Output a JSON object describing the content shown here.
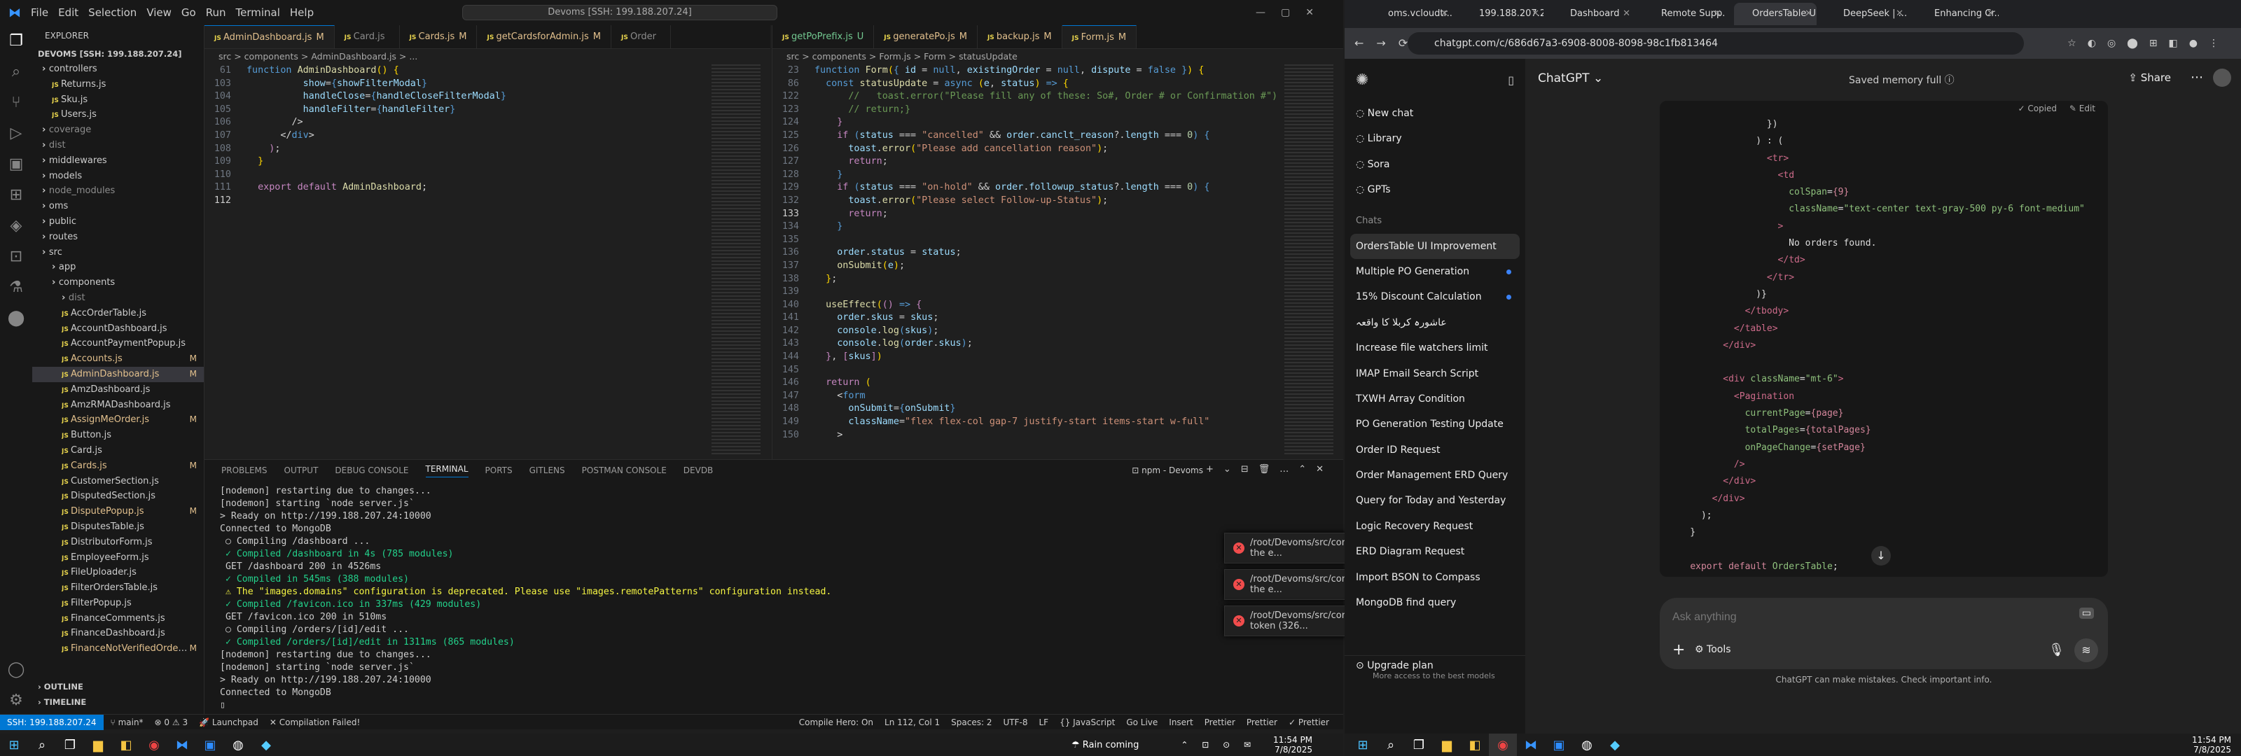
{
  "vscode": {
    "menu": [
      "File",
      "Edit",
      "Selection",
      "View",
      "Go",
      "Run",
      "Terminal",
      "Help"
    ],
    "search": "Devoms [SSH: 199.188.207.24]",
    "explorer_title": "EXPLORER",
    "workspace": "DEVOMS [SSH: 199.188.207.24]",
    "tree": [
      {
        "label": "controllers",
        "type": "folder",
        "status": ""
      },
      {
        "label": "Returns.js",
        "type": "file",
        "status": ""
      },
      {
        "label": "Sku.js",
        "type": "file",
        "status": ""
      },
      {
        "label": "Users.js",
        "type": "file",
        "status": ""
      },
      {
        "label": "coverage",
        "type": "folder",
        "status": ""
      },
      {
        "label": "dist",
        "type": "folder",
        "status": ""
      },
      {
        "label": "middlewares",
        "type": "folder",
        "status": ""
      },
      {
        "label": "models",
        "type": "folder",
        "status": ""
      },
      {
        "label": "node_modules",
        "type": "folder",
        "status": ""
      },
      {
        "label": "oms",
        "type": "folder",
        "status": ""
      },
      {
        "label": "public",
        "type": "folder",
        "status": ""
      },
      {
        "label": "routes",
        "type": "folder",
        "status": ""
      },
      {
        "label": "src",
        "type": "folder",
        "status": ""
      },
      {
        "label": "app",
        "type": "folder",
        "status": ""
      },
      {
        "label": "components",
        "type": "folder",
        "status": ""
      },
      {
        "label": "dist",
        "type": "folder",
        "status": ""
      },
      {
        "label": "AccOrderTable.js",
        "type": "file",
        "status": ""
      },
      {
        "label": "AccountDashboard.js",
        "type": "file",
        "status": ""
      },
      {
        "label": "AccountPaymentPopup.js",
        "type": "file",
        "status": ""
      },
      {
        "label": "Accounts.js",
        "type": "file",
        "status": "M"
      },
      {
        "label": "AdminDashboard.js",
        "type": "file",
        "status": "M"
      },
      {
        "label": "AmzDashboard.js",
        "type": "file",
        "status": ""
      },
      {
        "label": "AmzRMADashboard.js",
        "type": "file",
        "status": ""
      },
      {
        "label": "AssignMeOrder.js",
        "type": "file",
        "status": "M"
      },
      {
        "label": "Button.js",
        "type": "file",
        "status": ""
      },
      {
        "label": "Card.js",
        "type": "file",
        "status": ""
      },
      {
        "label": "Cards.js",
        "type": "file",
        "status": "M"
      },
      {
        "label": "CustomerSection.js",
        "type": "file",
        "status": ""
      },
      {
        "label": "DisputedSection.js",
        "type": "file",
        "status": ""
      },
      {
        "label": "DisputePopup.js",
        "type": "file",
        "status": "M"
      },
      {
        "label": "DisputesTable.js",
        "type": "file",
        "status": ""
      },
      {
        "label": "DistributorForm.js",
        "type": "file",
        "status": ""
      },
      {
        "label": "EmployeeForm.js",
        "type": "file",
        "status": ""
      },
      {
        "label": "FileUploader.js",
        "type": "file",
        "status": ""
      },
      {
        "label": "FilterOrdersTable.js",
        "type": "file",
        "status": ""
      },
      {
        "label": "FilterPopup.js",
        "type": "file",
        "status": ""
      },
      {
        "label": "FinanceComments.js",
        "type": "file",
        "status": ""
      },
      {
        "label": "FinanceDashboard.js",
        "type": "file",
        "status": ""
      },
      {
        "label": "FinanceNotVerifiedOrderT...",
        "type": "file",
        "status": "M"
      }
    ],
    "outline": "OUTLINE",
    "timeline": "TIMELINE",
    "tabs1": [
      {
        "label": "AdminDashboard.js",
        "mod": "M",
        "active": true
      },
      {
        "label": "Card.js",
        "mod": "",
        "active": false
      },
      {
        "label": "Cards.js",
        "mod": "M",
        "active": false
      },
      {
        "label": "getCardsforAdmin.js",
        "mod": "M",
        "active": false
      },
      {
        "label": "Order",
        "mod": "",
        "active": false
      }
    ],
    "tabs2": [
      {
        "label": "getPoPrefix.js",
        "mod": "U",
        "active": false
      },
      {
        "label": "generatePo.js",
        "mod": "M",
        "active": false
      },
      {
        "label": "backup.js",
        "mod": "M",
        "active": false
      },
      {
        "label": "Form.js",
        "mod": "M",
        "active": true
      }
    ],
    "crumb1": "src > components > AdminDashboard.js > ...",
    "crumb2": "src > components > Form.js > Form > statusUpdate",
    "panel_tabs": [
      "PROBLEMS",
      "OUTPUT",
      "DEBUG CONSOLE",
      "TERMINAL",
      "PORTS",
      "GITLENS",
      "POSTMAN CONSOLE",
      "DEVDB"
    ],
    "terminal_label": "npm - Devoms",
    "terminal": [
      "[nodemon] restarting due to changes...",
      "[nodemon] starting `node server.js`",
      "> Ready on http://199.188.207.24:10000",
      "Connected to MongoDB",
      " ○ Compiling /dashboard ...",
      " ✓ Compiled /dashboard in 4s (785 modules)",
      " GET /dashboard 200 in 4526ms",
      " ✓ Compiled in 545ms (388 modules)",
      " ⚠ The \"images.domains\" configuration is deprecated. Please use \"images.remotePatterns\" configuration instead.",
      " ✓ Compiled /favicon.ico in 337ms (429 modules)",
      " GET /favicon.ico 200 in 510ms",
      " ○ Compiling /orders/[id]/edit ...",
      " ✓ Compiled /orders/[id]/edit in 1311ms (865 modules)",
      "[nodemon] restarting due to changes...",
      "[nodemon] starting `node server.js`",
      "> Ready on http://199.188.207.24:10000",
      "Connected to MongoDB",
      "▯"
    ],
    "notifications": [
      "/root/Devoms/src/components/AdminDashboard.js: Support for the e...",
      "/root/Devoms/src/components/AdminDashboard.js: Support for the e...",
      "/root/Devoms/src/components/OrdersTable.js: Unexpected token (326..."
    ],
    "status": {
      "ssh": "SSH: 199.188.207.24",
      "branch": "main*",
      "errors": "⊗ 0 ⚠ 3",
      "launchpad": "Launchpad",
      "compile": "Compilation Failed!",
      "right": [
        "Compile Hero: On",
        "Ln 112, Col 1",
        "Spaces: 2",
        "UTF-8",
        "LF",
        "{} JavaScript",
        "Go Live",
        "Insert",
        "Prettier",
        "Prettier",
        "✓ Prettier"
      ]
    }
  },
  "browser": {
    "tabs": [
      {
        "label": "oms.vcloudtr...",
        "active": false
      },
      {
        "label": "199.188.207.2...",
        "active": false
      },
      {
        "label": "Dashboard",
        "active": false
      },
      {
        "label": "Remote Supp...",
        "active": false
      },
      {
        "label": "OrdersTable U",
        "active": true
      },
      {
        "label": "DeepSeek | ...",
        "active": false
      },
      {
        "label": "Enhancing Cr...",
        "active": false
      }
    ],
    "url": "chatgpt.com/c/686d67a3-6908-8008-8098-98c1fb813464",
    "model": "ChatGPT",
    "memory": "Saved memory full",
    "share": "Share",
    "nav": [
      {
        "label": "New chat",
        "icon": "new-chat-icon"
      },
      {
        "label": "Library",
        "icon": "library-icon"
      },
      {
        "label": "Sora",
        "icon": "sora-icon"
      },
      {
        "label": "GPTs",
        "icon": "gpts-icon"
      }
    ],
    "chats_heading": "Chats",
    "chats": [
      {
        "label": "OrdersTable UI Improvement",
        "active": true,
        "dot": false
      },
      {
        "label": "Multiple PO Generation",
        "active": false,
        "dot": true
      },
      {
        "label": "15% Discount Calculation",
        "active": false,
        "dot": true
      },
      {
        "label": "عاشورہ کربلا کا واقعہ",
        "active": false,
        "dot": false
      },
      {
        "label": "Increase file watchers limit",
        "active": false,
        "dot": false
      },
      {
        "label": "IMAP Email Search Script",
        "active": false,
        "dot": false
      },
      {
        "label": "TXWH Array Condition",
        "active": false,
        "dot": false
      },
      {
        "label": "PO Generation Testing Update",
        "active": false,
        "dot": false
      },
      {
        "label": "Order ID Request",
        "active": false,
        "dot": false
      },
      {
        "label": "Order Management ERD Query",
        "active": false,
        "dot": false
      },
      {
        "label": "Query for Today and Yesterday",
        "active": false,
        "dot": false
      },
      {
        "label": "Logic Recovery Request",
        "active": false,
        "dot": false
      },
      {
        "label": "ERD Diagram Request",
        "active": false,
        "dot": false
      },
      {
        "label": "Import BSON to Compass",
        "active": false,
        "dot": false
      },
      {
        "label": "MongoDB find query",
        "active": false,
        "dot": false
      }
    ],
    "upgrade": "Upgrade plan",
    "upgrade_sub": "More access to the best models",
    "copied": "Copied",
    "edit": "Edit",
    "composer_placeholder": "Ask anything",
    "tools": "Tools",
    "disclaimer": "ChatGPT can make mistakes. Check important info."
  },
  "taskbar_left": {
    "weather": "Rain coming",
    "time": "11:54 PM",
    "date": "7/8/2025"
  },
  "taskbar_right": {
    "time": "11:54 PM",
    "date": "7/8/2025"
  }
}
